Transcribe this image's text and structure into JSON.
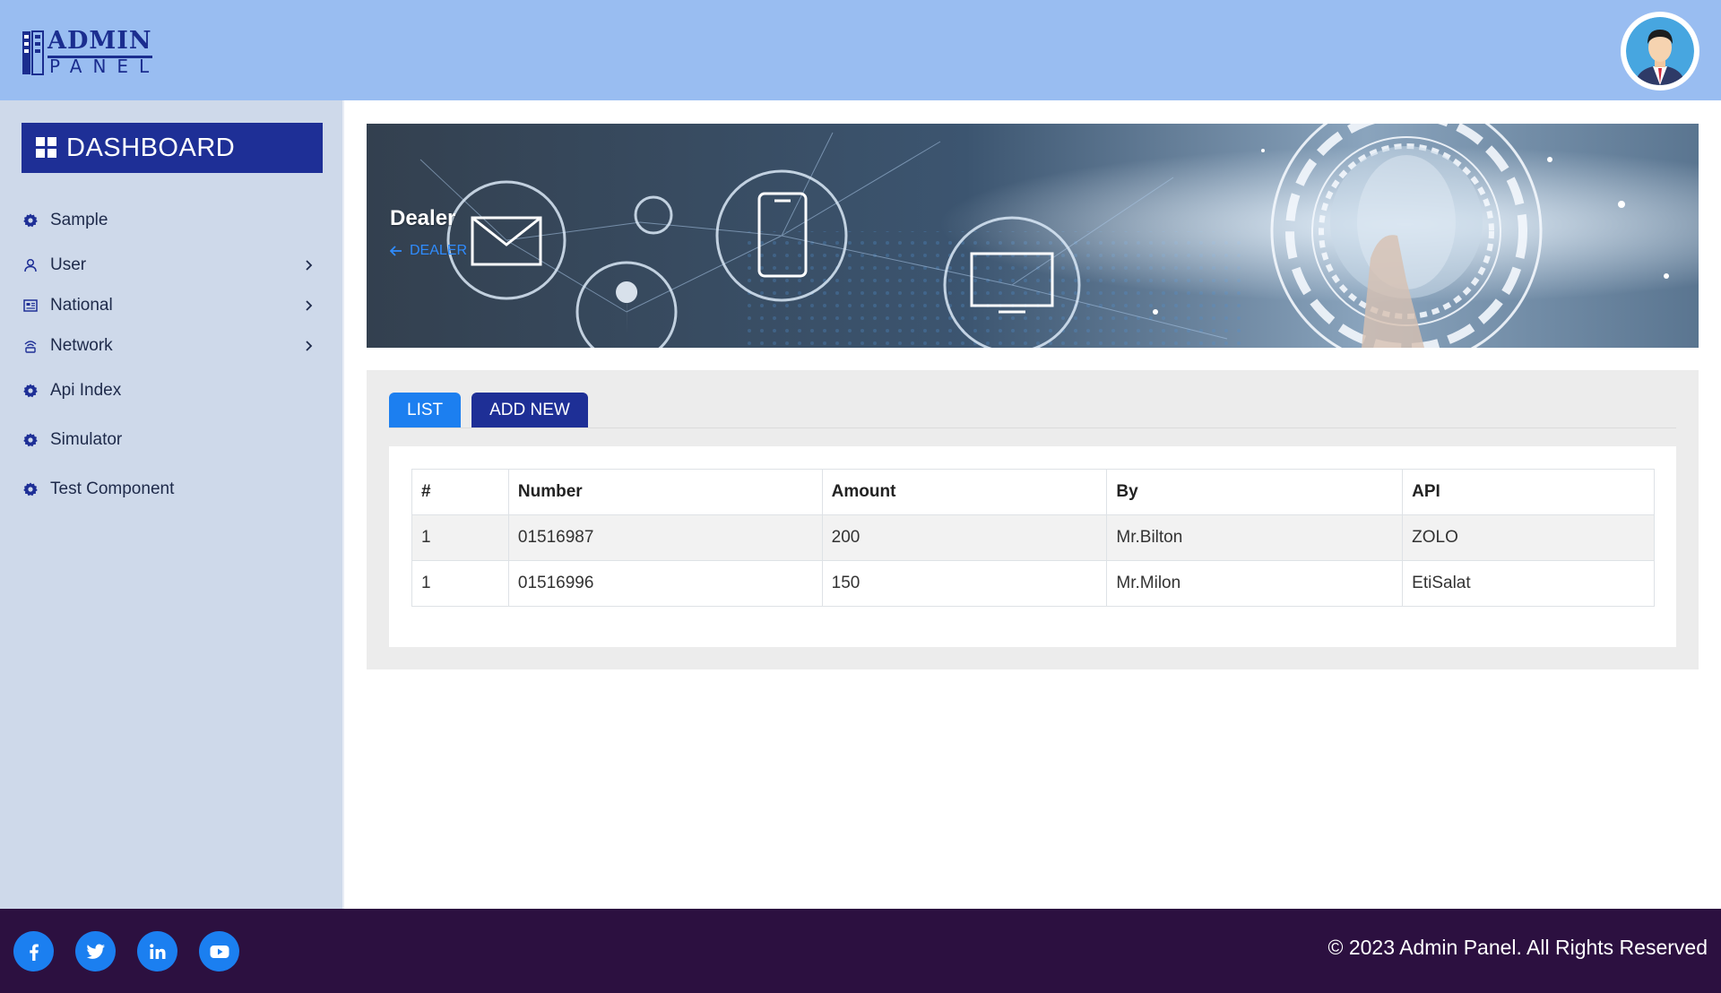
{
  "header": {
    "logo_line1": "ADMIN",
    "logo_line2": "PANEL"
  },
  "sidebar": {
    "dashboard_label": "DASHBOARD",
    "items": [
      {
        "label": "Sample",
        "icon": "gear-icon",
        "has_submenu": false
      },
      {
        "label": "User",
        "icon": "user-icon",
        "has_submenu": true
      },
      {
        "label": "National",
        "icon": "newspaper-icon",
        "has_submenu": true
      },
      {
        "label": "Network",
        "icon": "network-icon",
        "has_submenu": true
      },
      {
        "label": "Api Index",
        "icon": "gear-icon",
        "has_submenu": false
      },
      {
        "label": "Simulator",
        "icon": "gear-icon",
        "has_submenu": false
      },
      {
        "label": "Test Component",
        "icon": "gear-icon",
        "has_submenu": false
      }
    ]
  },
  "banner": {
    "title": "Dealer",
    "breadcrumb": "DEALER"
  },
  "tabs": {
    "list_label": "LIST",
    "add_label": "ADD NEW"
  },
  "table": {
    "headers": [
      "#",
      "Number",
      "Amount",
      "By",
      "API"
    ],
    "rows": [
      [
        "1",
        "01516987",
        "200",
        "Mr.Bilton",
        "ZOLO"
      ],
      [
        "1",
        "01516996",
        "150",
        "Mr.Milon",
        "EtiSalat"
      ]
    ]
  },
  "footer": {
    "social": [
      "facebook-icon",
      "twitter-icon",
      "linkedin-icon",
      "youtube-icon"
    ],
    "copyright": "© 2023 Admin Panel. All Rights Reserved"
  },
  "colors": {
    "header_bg": "#99bdf1",
    "sidebar_bg": "#ced9ea",
    "brand_dark": "#1e2f96",
    "accent_blue": "#1c7ff0",
    "footer_bg": "#2c1040"
  }
}
